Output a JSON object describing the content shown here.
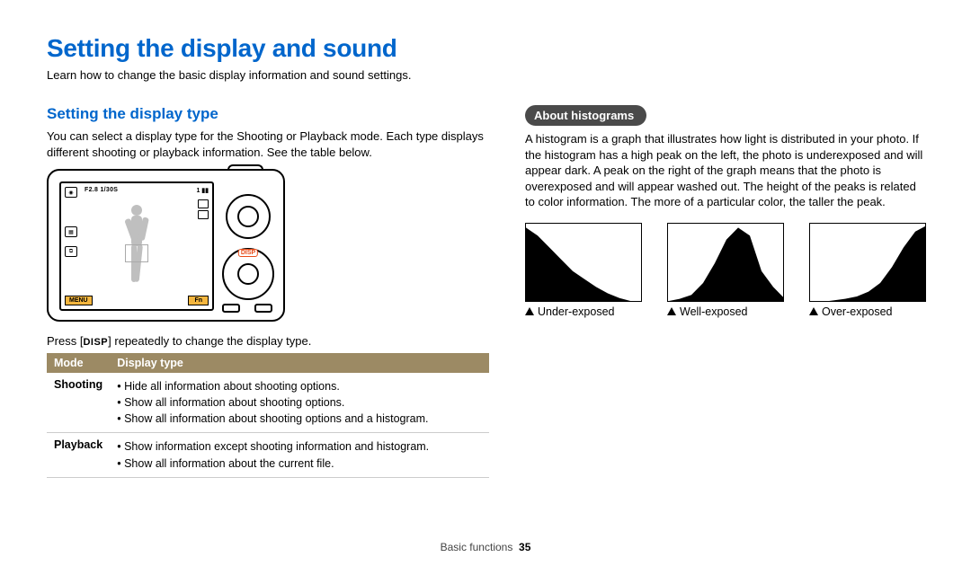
{
  "title": "Setting the display and sound",
  "lead": "Learn how to change the basic display information and sound settings.",
  "left": {
    "heading": "Setting the display type",
    "body": "You can select a display type for the Shooting or Playback mode. Each type displays different shooting or playback information. See the table below.",
    "camera": {
      "top_info": "F2.8 1/30S",
      "menu": "MENU",
      "fn": "Fn",
      "disp": "DISP",
      "count": "1"
    },
    "press_prefix": "Press [",
    "press_disp": "DISP",
    "press_suffix": "] repeatedly to change the display type.",
    "table": {
      "h1": "Mode",
      "h2": "Display type",
      "rows": [
        {
          "mode": "Shooting",
          "items": [
            "Hide all information about shooting options.",
            "Show all information about shooting options.",
            "Show all information about shooting options and a histogram."
          ]
        },
        {
          "mode": "Playback",
          "items": [
            "Show information except shooting information and histogram.",
            "Show all information about the current file."
          ]
        }
      ]
    }
  },
  "right": {
    "badge": "About histograms",
    "body": "A histogram is a graph that illustrates how light is distributed in your photo. If the histogram has a high peak on the left, the photo is underexposed and will appear dark. A peak on the right of the graph means that the photo is overexposed and will appear washed out. The height of the peaks is related to color information. The more of a particular color, the taller the peak.",
    "captions": [
      "Under-exposed",
      "Well-exposed",
      "Over-exposed"
    ]
  },
  "footer": {
    "section": "Basic functions",
    "page": "35"
  },
  "chart_data": [
    {
      "type": "area",
      "title": "Under-exposed histogram",
      "xlabel": "",
      "ylabel": "",
      "x": [
        0,
        10,
        20,
        30,
        40,
        50,
        60,
        70,
        80,
        90,
        100
      ],
      "values": [
        95,
        85,
        70,
        55,
        40,
        30,
        20,
        12,
        6,
        2,
        0
      ],
      "xlim": [
        0,
        100
      ],
      "ylim": [
        0,
        100
      ]
    },
    {
      "type": "area",
      "title": "Well-exposed histogram",
      "xlabel": "",
      "ylabel": "",
      "x": [
        0,
        10,
        20,
        30,
        40,
        50,
        60,
        70,
        80,
        90,
        100
      ],
      "values": [
        2,
        5,
        10,
        25,
        50,
        80,
        95,
        85,
        40,
        20,
        5
      ],
      "xlim": [
        0,
        100
      ],
      "ylim": [
        0,
        100
      ]
    },
    {
      "type": "area",
      "title": "Over-exposed histogram",
      "xlabel": "",
      "ylabel": "",
      "x": [
        0,
        10,
        20,
        30,
        40,
        50,
        60,
        70,
        80,
        90,
        100
      ],
      "values": [
        0,
        1,
        3,
        5,
        8,
        14,
        25,
        45,
        70,
        90,
        98
      ],
      "xlim": [
        0,
        100
      ],
      "ylim": [
        0,
        100
      ]
    }
  ]
}
